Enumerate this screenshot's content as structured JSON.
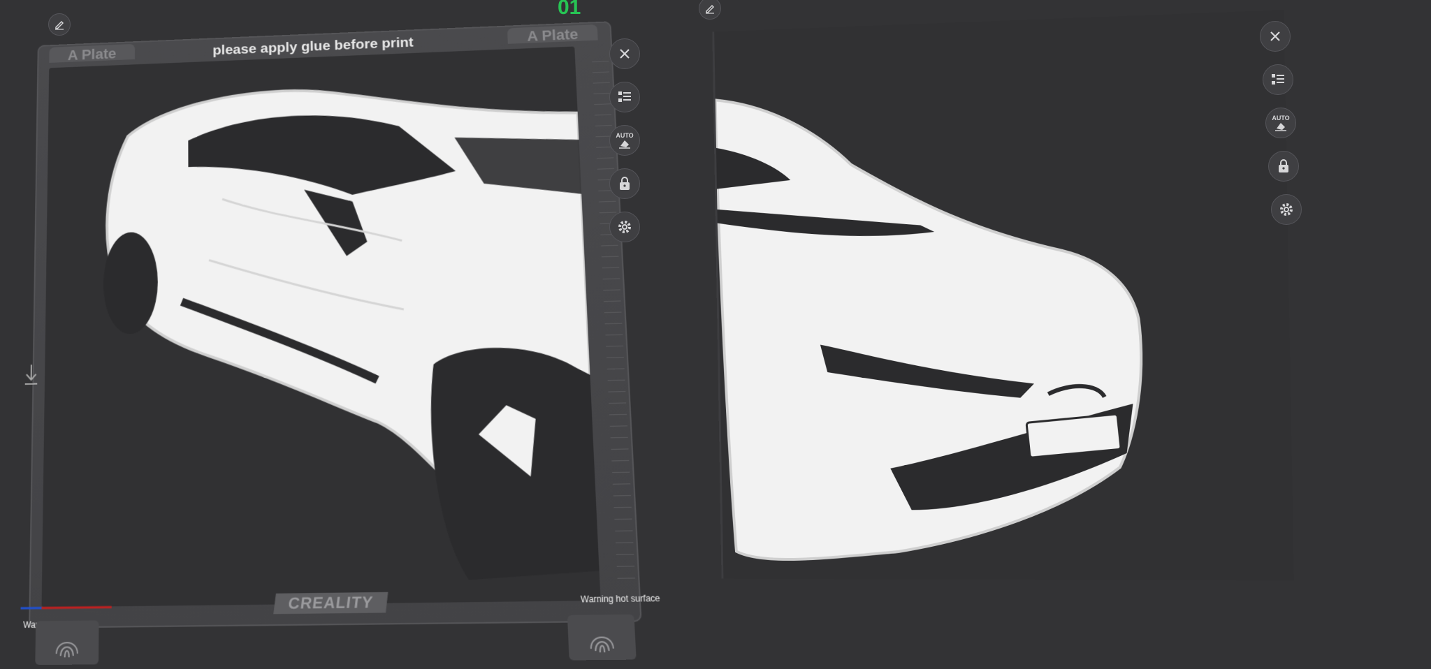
{
  "plate1": {
    "number": "01",
    "label_left": "A Plate",
    "label_right": "A Plate",
    "notice": "please apply glue before print",
    "brand": "CREALITY",
    "warning_left": "Warning hot surface",
    "warning_right": "Warning hot surface"
  },
  "toolbar_icons": [
    "close-icon",
    "arrange-icon",
    "auto-orient-icon",
    "lock-icon",
    "settings-icon"
  ],
  "colors": {
    "accent_green": "#27c454",
    "background": "#333335",
    "bed": "#313133",
    "model": "#f2f2f2"
  }
}
